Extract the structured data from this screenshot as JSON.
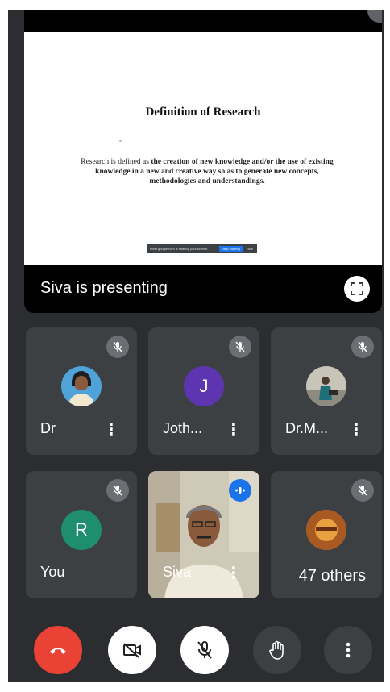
{
  "presentation": {
    "slide": {
      "title": "Definition of Research",
      "body_plain": "Research is defined as ",
      "body_bold": "the creation of new knowledge and/or the use of existing knowledge in a new and creative way so as to generate new concepts, methodologies and understandings.",
      "share_bar_text": "meet.google.com is sharing your screen.",
      "share_bar_stop": "Stop sharing",
      "share_bar_hide": "Hide"
    },
    "presenting_label": "Siva is presenting",
    "fullscreen_icon": "fullscreen-icon"
  },
  "participants": [
    {
      "name": "Dr",
      "avatar": "photo",
      "avatar_color": "#4fa3d8"
    },
    {
      "name": "Joth...",
      "avatar": "J",
      "avatar_color": "#5e35b1"
    },
    {
      "name": "Dr.M...",
      "avatar": "photo",
      "avatar_color": "#c9c4b8"
    },
    {
      "name": "You",
      "avatar": "R",
      "avatar_color": "#1e8e6e"
    },
    {
      "name": "Siva",
      "avatar": "video",
      "speaking": true
    },
    {
      "name": "47 others",
      "avatar": "photo",
      "avatar_color": "#c8742e"
    }
  ],
  "controls": {
    "end_call": {
      "icon": "phone-hangup-icon",
      "color": "#ea4335"
    },
    "camera": {
      "icon": "camera-off-icon"
    },
    "mic": {
      "icon": "mic-off-icon"
    },
    "raise_hand": {
      "icon": "hand-icon"
    },
    "more": {
      "icon": "more-vert-icon"
    }
  },
  "colors": {
    "background": "#2b2d30",
    "tile": "#3c4043",
    "accent_speaking": "#1a73e8"
  }
}
